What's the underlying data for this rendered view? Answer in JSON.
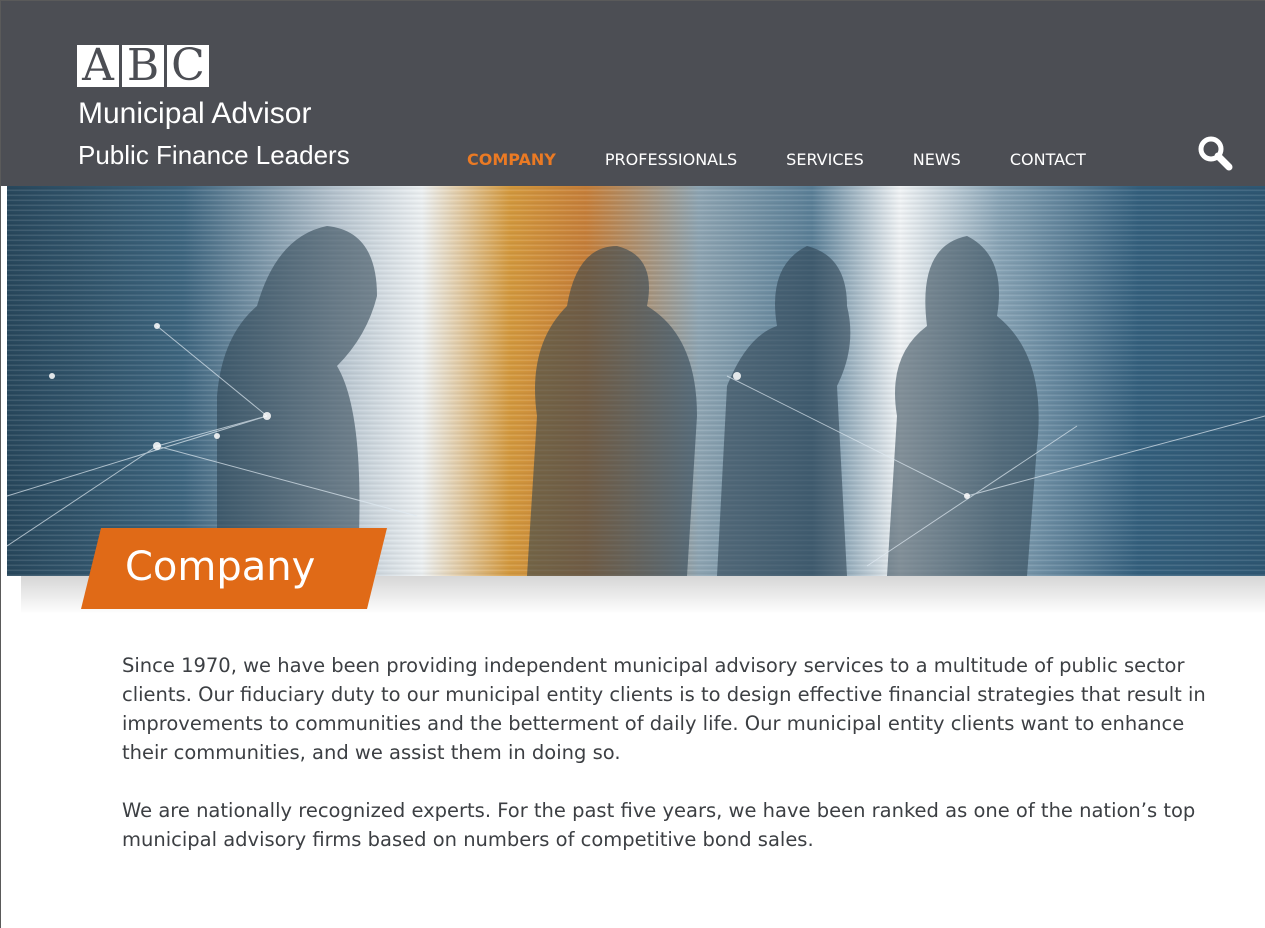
{
  "brand": {
    "mark_letters": [
      "A",
      "B",
      "C"
    ],
    "name_line1": "Municipal Advisor",
    "name_line2": "Public Finance Leaders"
  },
  "nav": {
    "items": [
      {
        "label": "COMPANY",
        "active": true
      },
      {
        "label": "PROFESSIONALS",
        "active": false
      },
      {
        "label": "SERVICES",
        "active": false
      },
      {
        "label": "NEWS",
        "active": false
      },
      {
        "label": "CONTACT",
        "active": false
      }
    ],
    "search_icon": "search-icon"
  },
  "hero": {
    "page_title": "Company"
  },
  "content": {
    "paragraphs": [
      "Since 1970, we have been providing independent municipal advisory services to a multitude of public sector clients. Our fiduciary duty to our municipal entity clients is to design effective financial strategies that result in improvements to communities and the betterment of daily life. Our municipal entity clients want to enhance their communities, and we assist them in doing so.",
      "We are nationally recognized experts. For the past five years, we have been ranked as one of the nation’s top municipal advisory firms based on numbers of competitive bond sales."
    ]
  },
  "colors": {
    "header_bg": "#4c4e54",
    "accent": "#ea7a24",
    "tag_bg": "#e06a17",
    "body_text": "#3c3f43"
  }
}
